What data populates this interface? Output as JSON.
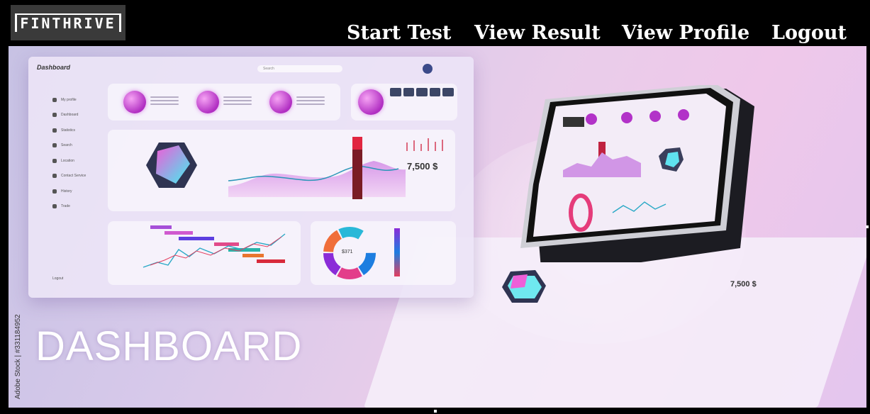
{
  "header": {
    "logo_text": "FINTHRIVE",
    "nav": {
      "start_test": "Start Test",
      "view_result": "View Result",
      "view_profile": "View Profile",
      "logout": "Logout"
    }
  },
  "banner": {
    "headline": "DASHBOARD",
    "watermark": "Adobe Stock | #331184952",
    "mock": {
      "logo": "Dashboard",
      "search_placeholder": "Search",
      "sidebar": [
        "My profile",
        "Dashboard",
        "Statistics",
        "Search",
        "Location",
        "Contact Service",
        "History",
        "Trade"
      ],
      "logout": "Logout",
      "price": "7,500 $",
      "donut_center": "$371"
    }
  },
  "colors": {
    "nav_text": "#ffffff",
    "topbar_bg": "#000000",
    "logo_bg": "#3a3a3a",
    "accent_magenta": "#c33bd1"
  }
}
